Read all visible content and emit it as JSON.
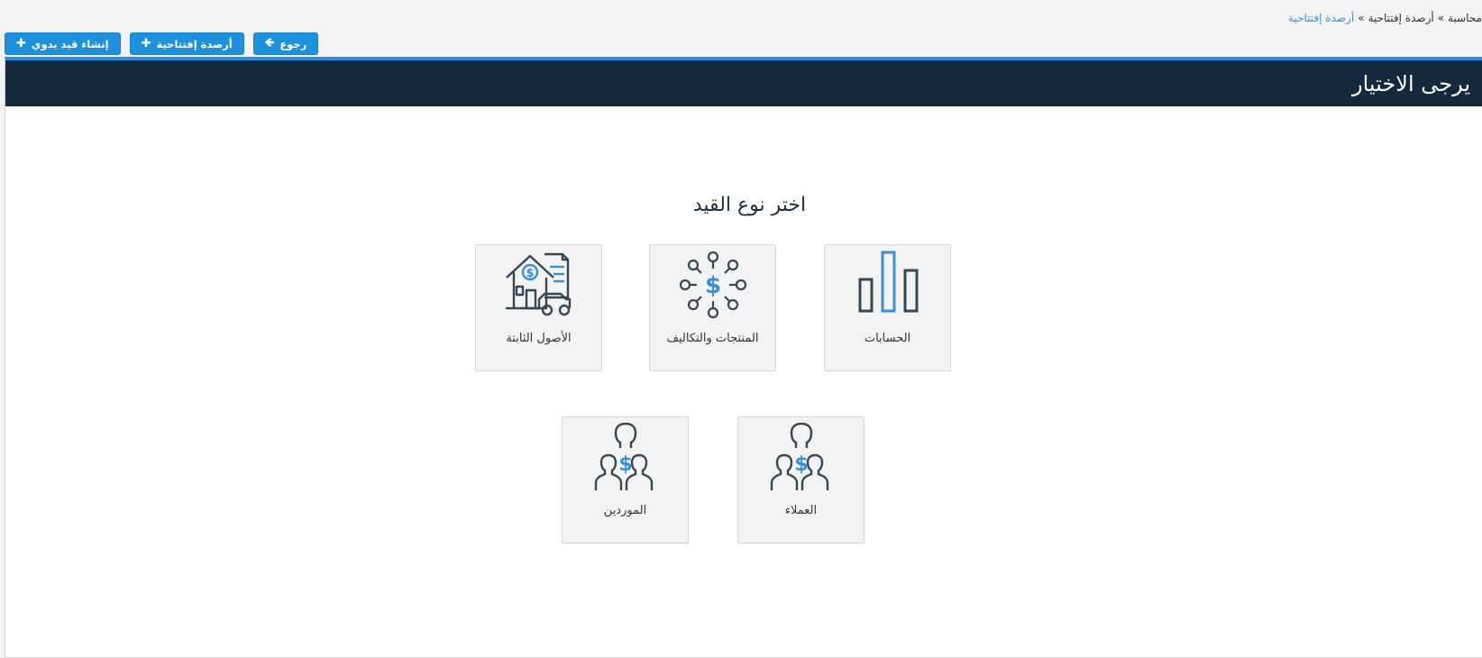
{
  "breadcrumb": {
    "first": "محاسبة",
    "second": "أرصدة إفتتاحية",
    "current": "أرصدة إفتتاحية",
    "separator": "»"
  },
  "actions": {
    "back": "رجوع",
    "opening_balances": "أرصدة إفتتاحية",
    "create_manual_entry": "إنشاء قيد يدوي"
  },
  "panel": {
    "title": "يرجى الاختيار"
  },
  "content": {
    "heading": "اختر نوع القيد",
    "tiles": {
      "accounts": "الحسابات",
      "products_costs": "المنتجات والتكاليف",
      "fixed_assets": "الأصول الثابتة",
      "customers": "العملاء",
      "suppliers": "الموردين"
    }
  },
  "colors": {
    "accent": "#1e91dd",
    "header_bg": "#15293d",
    "icon_dark": "#37474f",
    "icon_blue": "#3a8fd6"
  }
}
